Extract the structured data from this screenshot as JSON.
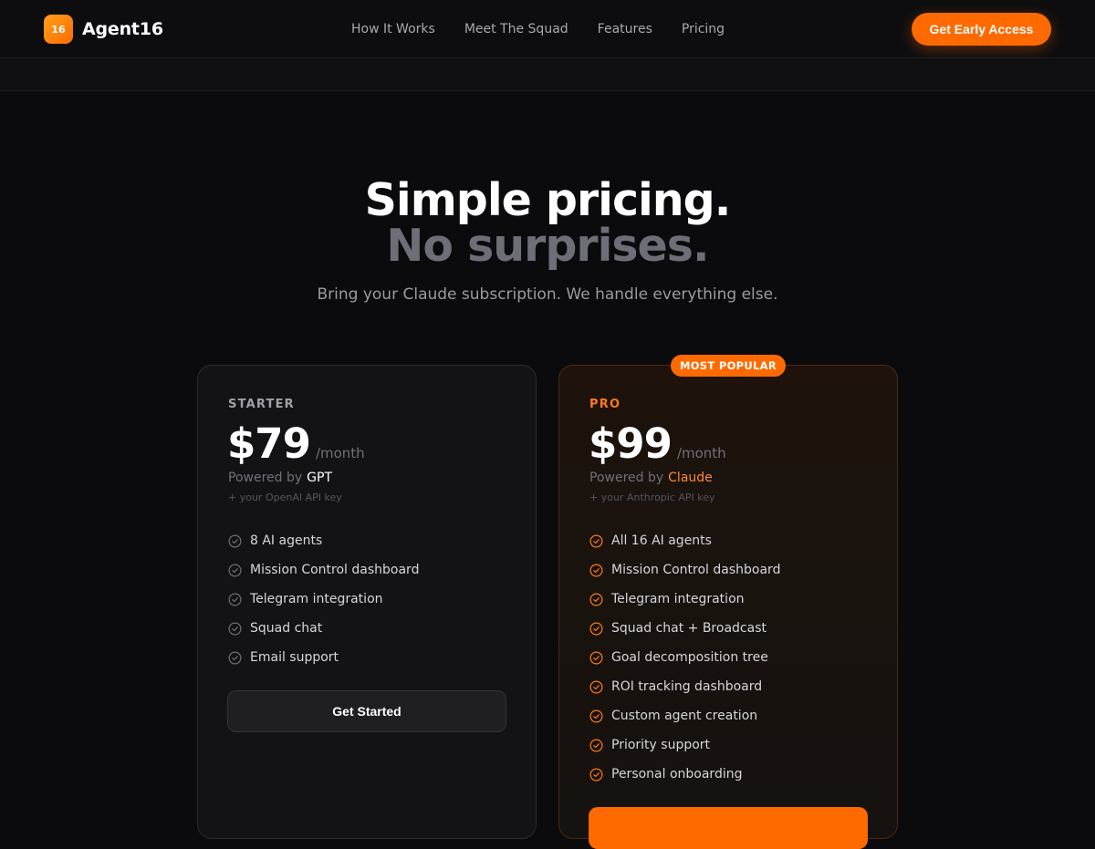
{
  "header": {
    "logo_badge": "16",
    "brand": "Agent16",
    "nav": [
      {
        "label": "How It Works"
      },
      {
        "label": "Meet The Squad"
      },
      {
        "label": "Features"
      },
      {
        "label": "Pricing"
      }
    ],
    "cta_label": "Get Early Access"
  },
  "hero": {
    "headline_line1": "Simple pricing.",
    "headline_line2": "No surprises.",
    "subheadline": "Bring your Claude subscription. We handle everything else."
  },
  "plans": [
    {
      "name": "STARTER",
      "price": "$79",
      "period": "/month",
      "powered_prefix": "Powered by",
      "powered_model": "GPT",
      "api_note": "+ your OpenAI API key",
      "features": [
        "8 AI agents",
        "Mission Control dashboard",
        "Telegram integration",
        "Squad chat",
        "Email support"
      ],
      "button_label": "Get Started"
    },
    {
      "badge": "MOST POPULAR",
      "name": "PRO",
      "price": "$99",
      "period": "/month",
      "powered_prefix": "Powered by",
      "powered_model": "Claude",
      "api_note": "+ your Anthropic API key",
      "features": [
        "All 16 AI agents",
        "Mission Control dashboard",
        "Telegram integration",
        "Squad chat + Broadcast",
        "Goal decomposition tree",
        "ROI tracking dashboard",
        "Custom agent creation",
        "Priority support",
        "Personal onboarding"
      ],
      "button_label": ""
    }
  ],
  "colors": {
    "accent": "#ff6a00",
    "background": "#0b0b0d",
    "card_starter": "#131316",
    "check_muted": "#6e6e78",
    "check_accent": "#ff7a1a"
  },
  "icons": {
    "feature_check": "check-circle-icon"
  }
}
